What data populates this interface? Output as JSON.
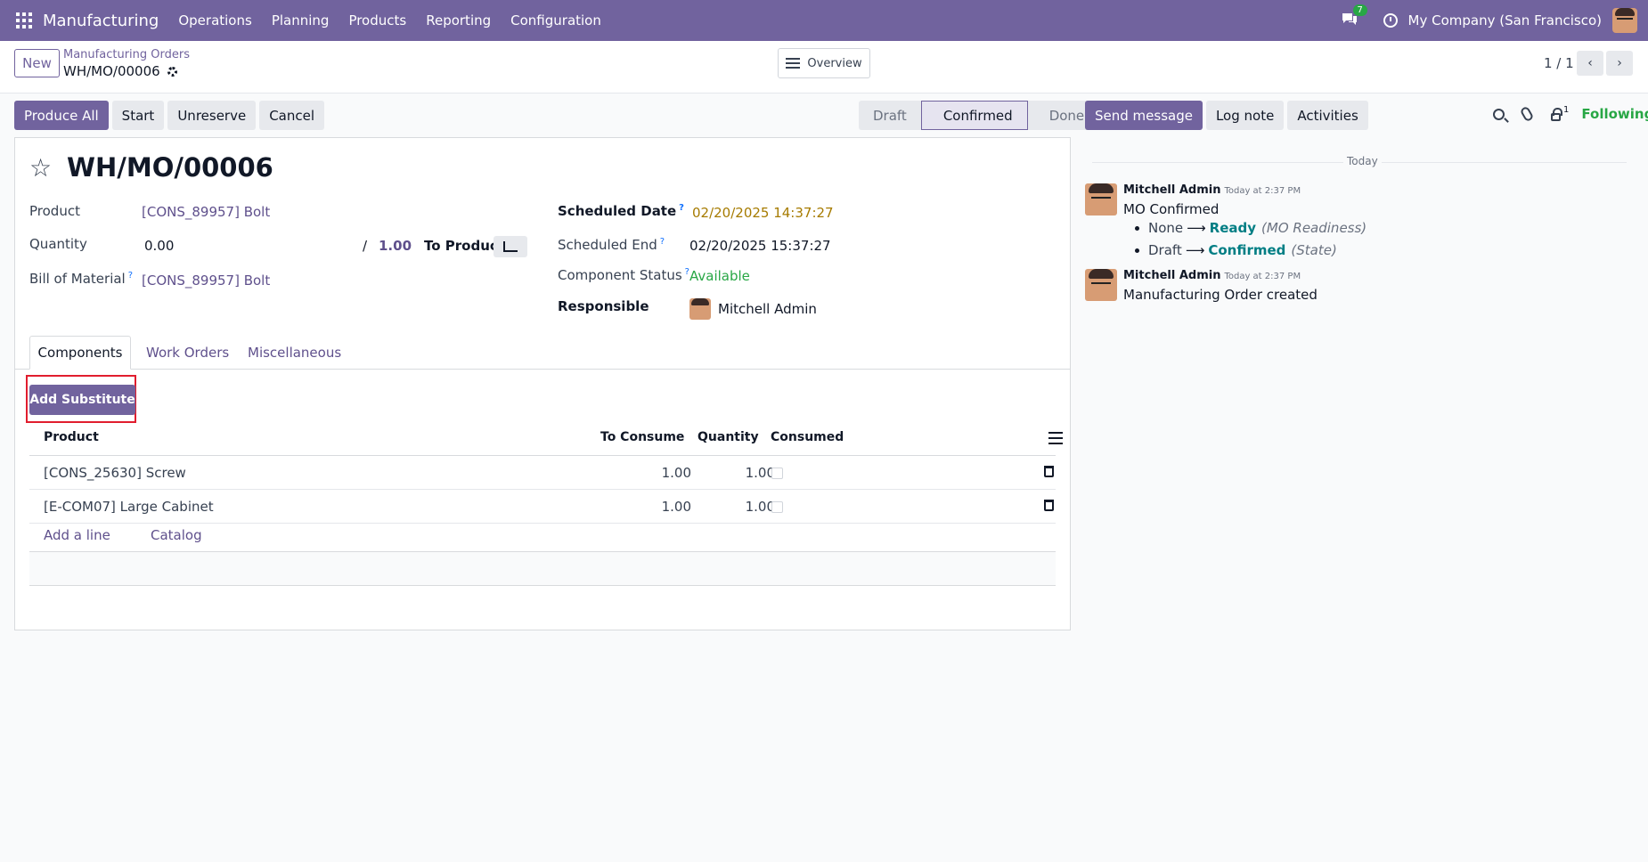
{
  "navbar": {
    "app_name": "Manufacturing",
    "menu": [
      "Operations",
      "Planning",
      "Products",
      "Reporting",
      "Configuration"
    ],
    "chat_badge": "7",
    "company": "My Company (San Francisco)",
    "color": "#71639e"
  },
  "control": {
    "new_label": "New",
    "breadcrumb_parent": "Manufacturing Orders",
    "breadcrumb_current": "WH/MO/00006",
    "overview_label": "Overview",
    "pager": "1 / 1"
  },
  "actions": {
    "produce_all": "Produce All",
    "start": "Start",
    "unreserve": "Unreserve",
    "cancel": "Cancel"
  },
  "status": {
    "stages": [
      "Draft",
      "Confirmed",
      "Done"
    ],
    "active": "Confirmed"
  },
  "form": {
    "title": "WH/MO/00006",
    "product_label": "Product",
    "product_value": "[CONS_89957] Bolt",
    "quantity_label": "Quantity",
    "quantity_value": "0.00",
    "quantity_sep": "/",
    "quantity_target": "1.00",
    "to_produce_label": "To Produce",
    "bom_label": "Bill of Material",
    "bom_value": "[CONS_89957] Bolt",
    "scheduled_date_label": "Scheduled Date",
    "scheduled_date_value": "02/20/2025 14:37:27",
    "scheduled_end_label": "Scheduled End",
    "scheduled_end_value": "02/20/2025 15:37:27",
    "component_status_label": "Component Status",
    "component_status_value": "Available",
    "responsible_label": "Responsible",
    "responsible_value": "Mitchell Admin",
    "help_mark": "?"
  },
  "tabs": [
    "Components",
    "Work Orders",
    "Miscellaneous"
  ],
  "components": {
    "add_substitute": "Add Substitute",
    "headers": {
      "product": "Product",
      "to_consume": "To Consume",
      "quantity": "Quantity",
      "consumed": "Consumed"
    },
    "rows": [
      {
        "product": "[CONS_25630] Screw",
        "to_consume": "1.00",
        "quantity": "1.00"
      },
      {
        "product": "[E-COM07] Large Cabinet",
        "to_consume": "1.00",
        "quantity": "1.00"
      }
    ],
    "add_line": "Add a line",
    "catalog": "Catalog"
  },
  "chatter": {
    "send_message": "Send message",
    "log_note": "Log note",
    "activities": "Activities",
    "follower_count": "1",
    "following": "Following",
    "date_separator": "Today",
    "messages": [
      {
        "author": "Mitchell Admin",
        "time": "Today at 2:37 PM",
        "body": "MO Confirmed",
        "tracking": [
          {
            "old": "None",
            "new": "Ready",
            "field": "(MO Readiness)"
          },
          {
            "old": "Draft",
            "new": "Confirmed",
            "field": "(State)"
          }
        ]
      },
      {
        "author": "Mitchell Admin",
        "time": "Today at 2:37 PM",
        "body": "Manufacturing Order created"
      }
    ]
  }
}
